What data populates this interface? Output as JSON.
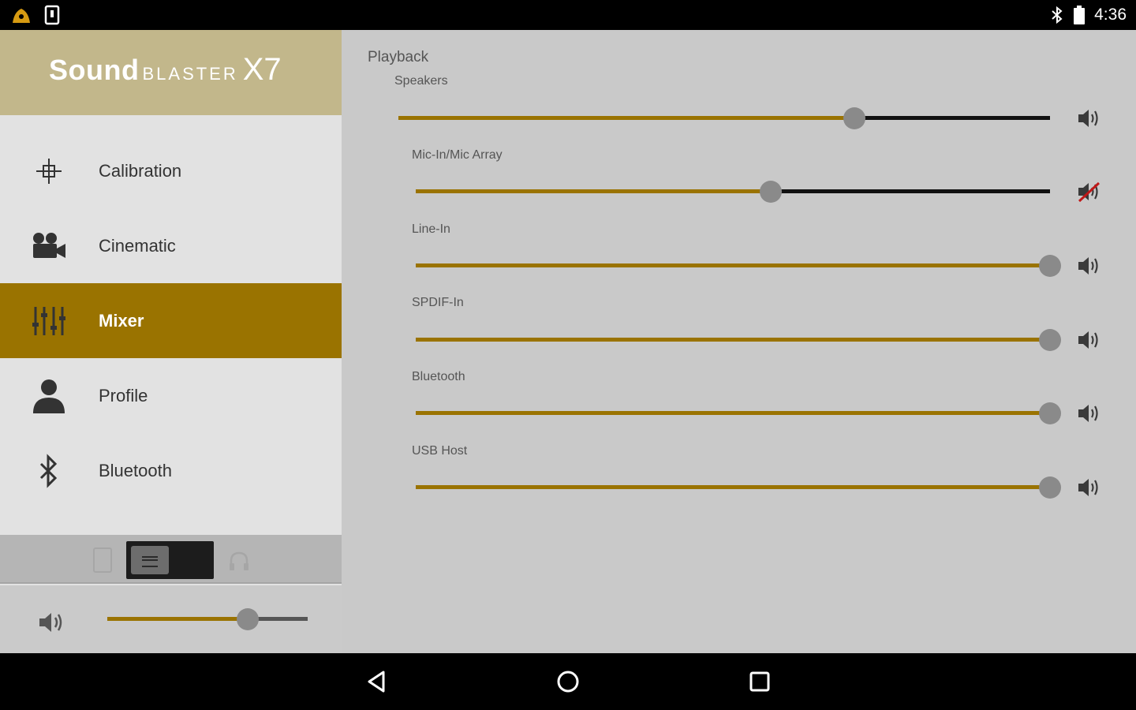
{
  "status_bar": {
    "time": "4:36"
  },
  "brand": {
    "word1": "Sound",
    "word2": "BLASTER",
    "word3": "X7"
  },
  "nav": [
    {
      "label": "Calibration",
      "icon": "crosshair-icon",
      "active": false
    },
    {
      "label": "Cinematic",
      "icon": "movie-camera-icon",
      "active": false
    },
    {
      "label": "Mixer",
      "icon": "mixer-sliders-icon",
      "active": true
    },
    {
      "label": "Profile",
      "icon": "person-icon",
      "active": false
    },
    {
      "label": "Bluetooth",
      "icon": "bluetooth-icon",
      "active": false
    }
  ],
  "output": {
    "mode": "speakers-headphones-toggle"
  },
  "master_volume": {
    "level": 0.7
  },
  "mixer": {
    "section_title": "Playback",
    "channels": [
      {
        "label": "Speakers",
        "level": 0.7,
        "muted": false
      },
      {
        "label": "Mic-In/Mic Array",
        "level": 0.56,
        "muted": true
      },
      {
        "label": "Line-In",
        "level": 1.0,
        "muted": false
      },
      {
        "label": "SPDIF-In",
        "level": 1.0,
        "muted": false
      },
      {
        "label": "Bluetooth",
        "level": 1.0,
        "muted": false
      },
      {
        "label": "USB Host",
        "level": 1.0,
        "muted": false
      }
    ]
  },
  "colors": {
    "accent": "#9a7300",
    "logo_band": "#c2b78b",
    "panel": "#c9c9c9",
    "sidebar": "#e2e2e2"
  }
}
